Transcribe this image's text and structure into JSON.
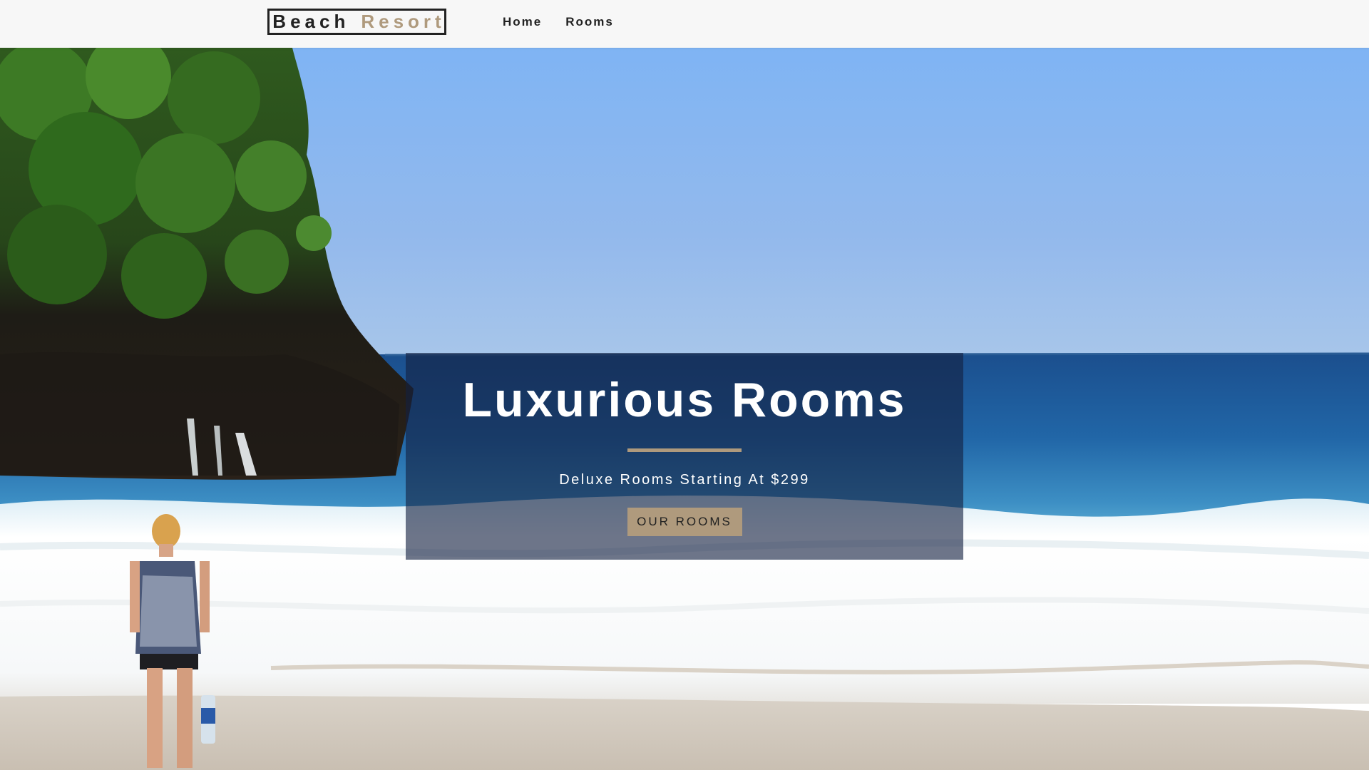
{
  "navbar": {
    "logo_first": "Beach",
    "logo_second": "Resort",
    "links": [
      {
        "label": "Home"
      },
      {
        "label": "Rooms"
      }
    ]
  },
  "hero": {
    "title": "Luxurious Rooms",
    "subtitle": "Deluxe Rooms Starting At $299",
    "button_label": "OUR ROOMS"
  },
  "colors": {
    "accent": "#af9a7d",
    "nav_background": "#f7f7f7",
    "text_dark": "#222222",
    "banner_overlay": "rgba(20,32,64,0.62)"
  }
}
